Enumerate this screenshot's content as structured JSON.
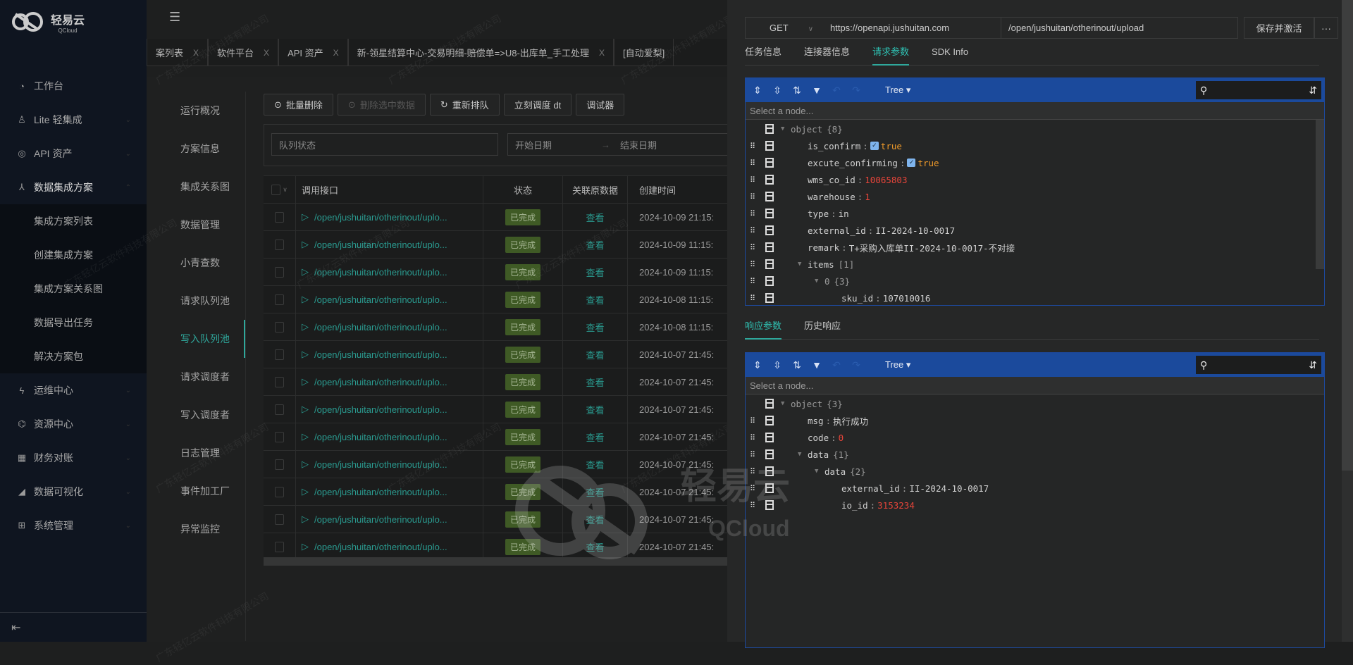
{
  "brand": {
    "name": "轻易云",
    "sub": "QCloud"
  },
  "sidebar": {
    "items": [
      {
        "label": "工作台",
        "icon": "clock-icon",
        "glyph": "◔"
      },
      {
        "label": "Lite 轻集成",
        "icon": "lamp-icon",
        "glyph": "♙",
        "chev": "⌄"
      },
      {
        "label": "API 资产",
        "icon": "compass-icon",
        "glyph": "◎",
        "chev": "⌄"
      },
      {
        "label": "数据集成方案",
        "icon": "network-icon",
        "glyph": "⅄",
        "chev": "⌃"
      }
    ],
    "subitems": [
      {
        "label": "集成方案列表"
      },
      {
        "label": "创建集成方案"
      },
      {
        "label": "集成方案关系图"
      },
      {
        "label": "数据导出任务"
      },
      {
        "label": "解决方案包"
      }
    ],
    "items2": [
      {
        "label": "运维中心",
        "icon": "lightning-icon",
        "glyph": "ϟ",
        "chev": "⌄"
      },
      {
        "label": "资源中心",
        "icon": "hierarchy-icon",
        "glyph": "⌬",
        "chev": "⌄"
      },
      {
        "label": "财务对账",
        "icon": "calculator-icon",
        "glyph": "▦",
        "chev": "⌄"
      },
      {
        "label": "数据可视化",
        "icon": "area-chart-icon",
        "glyph": "◢",
        "chev": "⌄"
      },
      {
        "label": "系统管理",
        "icon": "apps-icon",
        "glyph": "⊞",
        "chev": "⌄"
      }
    ]
  },
  "tabs": [
    {
      "label": "案列表"
    },
    {
      "label": "软件平台"
    },
    {
      "label": "API 资产"
    },
    {
      "label": "新-领星结算中心-交易明细-赔偿单=>U8-出库单_手工处理"
    },
    {
      "label": "[自动爱梨]"
    }
  ],
  "tab_close": "X",
  "subnav": [
    {
      "label": "运行概况"
    },
    {
      "label": "方案信息"
    },
    {
      "label": "集成关系图"
    },
    {
      "label": "数据管理"
    },
    {
      "label": "小青查数"
    },
    {
      "label": "请求队列池"
    },
    {
      "label": "写入队列池",
      "active": true
    },
    {
      "label": "请求调度者"
    },
    {
      "label": "写入调度者"
    },
    {
      "label": "日志管理"
    },
    {
      "label": "事件加工厂"
    },
    {
      "label": "异常监控"
    }
  ],
  "toolbar": {
    "batch_delete": "批量删除",
    "delete_selected": "删除选中数据",
    "requeue": "重新排队",
    "dispatch_now": "立刻调度 dt",
    "debugger": "调试器"
  },
  "filter": {
    "queue_status_placeholder": "队列状态",
    "start_date_placeholder": "开始日期",
    "end_date_placeholder": "结束日期",
    "range_sep": "→"
  },
  "table": {
    "headers": [
      "调用接口",
      "状态",
      "关联原数据",
      "创建时间"
    ],
    "rows": [
      {
        "api": "/open/jushuitan/otherinout/uplo...",
        "status": "已完成",
        "view": "查看",
        "created": "2024-10-09 21:15:"
      },
      {
        "api": "/open/jushuitan/otherinout/uplo...",
        "status": "已完成",
        "view": "查看",
        "created": "2024-10-09 11:15:"
      },
      {
        "api": "/open/jushuitan/otherinout/uplo...",
        "status": "已完成",
        "view": "查看",
        "created": "2024-10-09 11:15:"
      },
      {
        "api": "/open/jushuitan/otherinout/uplo...",
        "status": "已完成",
        "view": "查看",
        "created": "2024-10-08 11:15:"
      },
      {
        "api": "/open/jushuitan/otherinout/uplo...",
        "status": "已完成",
        "view": "查看",
        "created": "2024-10-08 11:15:"
      },
      {
        "api": "/open/jushuitan/otherinout/uplo...",
        "status": "已完成",
        "view": "查看",
        "created": "2024-10-07 21:45:"
      },
      {
        "api": "/open/jushuitan/otherinout/uplo...",
        "status": "已完成",
        "view": "查看",
        "created": "2024-10-07 21:45:"
      },
      {
        "api": "/open/jushuitan/otherinout/uplo...",
        "status": "已完成",
        "view": "查看",
        "created": "2024-10-07 21:45:"
      },
      {
        "api": "/open/jushuitan/otherinout/uplo...",
        "status": "已完成",
        "view": "查看",
        "created": "2024-10-07 21:45:"
      },
      {
        "api": "/open/jushuitan/otherinout/uplo...",
        "status": "已完成",
        "view": "查看",
        "created": "2024-10-07 21:45:"
      },
      {
        "api": "/open/jushuitan/otherinout/uplo...",
        "status": "已完成",
        "view": "查看",
        "created": "2024-10-07 21:45:"
      },
      {
        "api": "/open/jushuitan/otherinout/uplo...",
        "status": "已完成",
        "view": "查看",
        "created": "2024-10-07 21:45:"
      },
      {
        "api": "/open/jushuitan/otherinout/uplo...",
        "status": "已完成",
        "view": "查看",
        "created": "2024-10-07 21:45:"
      }
    ]
  },
  "panel": {
    "method": "GET",
    "base_url": "https://openapi.jushuitan.com",
    "path": "/open/jushuitan/otherinout/upload",
    "save_label": "保存并激活",
    "more_label": "···",
    "tabs": [
      {
        "label": "任务信息"
      },
      {
        "label": "连接器信息"
      },
      {
        "label": "请求参数",
        "active": true
      },
      {
        "label": "SDK Info"
      }
    ],
    "resp_tabs": [
      {
        "label": "响应参数",
        "active": true
      },
      {
        "label": "历史响应"
      }
    ],
    "editor_mode": "Tree",
    "node_placeholder": "Select a node...",
    "request_tree": [
      {
        "depth": 0,
        "key": "object",
        "meta": "{8}",
        "expand": true,
        "root": true
      },
      {
        "depth": 1,
        "key": "is_confirm",
        "value": "true",
        "type": "bool"
      },
      {
        "depth": 1,
        "key": "excute_confirming",
        "value": "true",
        "type": "bool"
      },
      {
        "depth": 1,
        "key": "wms_co_id",
        "value": "10065803",
        "type": "num"
      },
      {
        "depth": 1,
        "key": "warehouse",
        "value": "1",
        "type": "num"
      },
      {
        "depth": 1,
        "key": "type",
        "value": "in",
        "type": "str"
      },
      {
        "depth": 1,
        "key": "external_id",
        "value": "II-2024-10-0017",
        "type": "str"
      },
      {
        "depth": 1,
        "key": "remark",
        "value": "T+采购入库单II-2024-10-0017-不对接",
        "type": "str"
      },
      {
        "depth": 1,
        "key": "items",
        "meta": "[1]",
        "expand": true
      },
      {
        "depth": 2,
        "key": "0",
        "meta": "{3}",
        "expand": true,
        "index": true
      },
      {
        "depth": 3,
        "key": "sku_id",
        "value": "107010016",
        "type": "str"
      }
    ],
    "response_tree": [
      {
        "depth": 0,
        "key": "object",
        "meta": "{3}",
        "expand": true,
        "root": true
      },
      {
        "depth": 1,
        "key": "msg",
        "value": "执行成功",
        "type": "str"
      },
      {
        "depth": 1,
        "key": "code",
        "value": "0",
        "type": "num"
      },
      {
        "depth": 1,
        "key": "data",
        "meta": "{1}",
        "expand": true
      },
      {
        "depth": 2,
        "key": "data",
        "meta": "{2}",
        "expand": true
      },
      {
        "depth": 3,
        "key": "external_id",
        "value": "II-2024-10-0017",
        "type": "str"
      },
      {
        "depth": 3,
        "key": "io_id",
        "value": "3153234",
        "type": "num"
      }
    ]
  },
  "watermark": {
    "text": "广东轻亿云软件科技有限公司",
    "logo_text": "轻易云",
    "logo_sub": "QCloud"
  },
  "colors": {
    "accent": "#2fa89c",
    "editor_toolbar": "#1b4a9c",
    "number": "#e8453a",
    "boolean": "#ef9a2a",
    "status_badge": "#3f5a25"
  }
}
